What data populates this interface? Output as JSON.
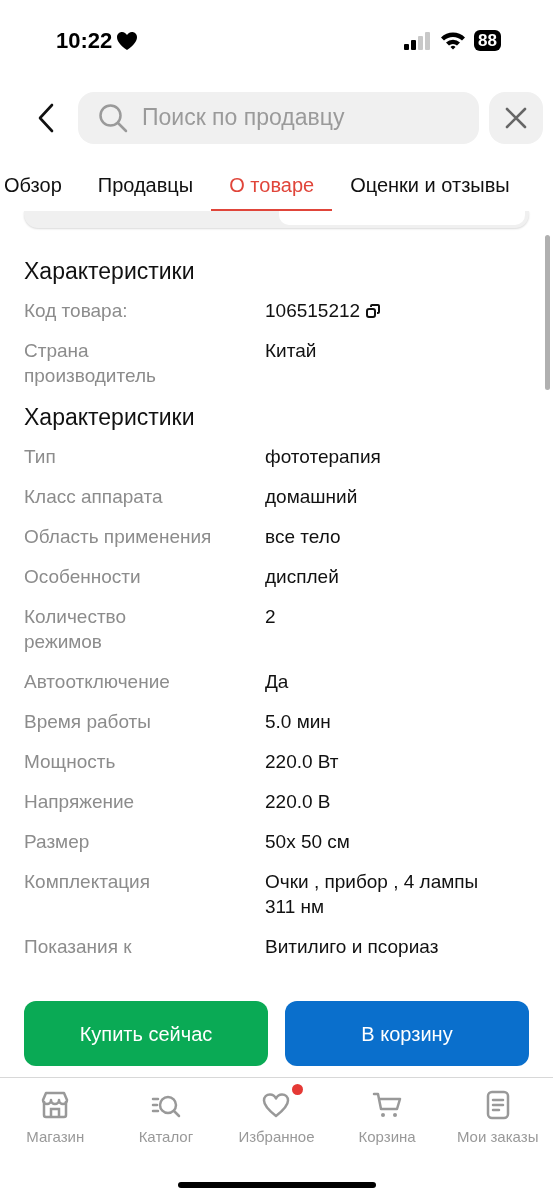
{
  "status_bar": {
    "time": "10:22",
    "battery": "88"
  },
  "search": {
    "placeholder": "Поиск по продавцу"
  },
  "tabs": [
    {
      "label": "Обзор",
      "selected": false
    },
    {
      "label": "Продавцы",
      "selected": false
    },
    {
      "label": "О товаре",
      "selected": true
    },
    {
      "label": "Оценки и отзывы",
      "selected": false
    }
  ],
  "sections": [
    {
      "title": "Характеристики",
      "rows": [
        {
          "label": "Код товара:",
          "value": "106515212",
          "copyable": true
        },
        {
          "label": "Страна\nпроизводитель",
          "value": "Китай"
        }
      ]
    },
    {
      "title": "Характеристики",
      "rows": [
        {
          "label": "Тип",
          "value": "фототерапия"
        },
        {
          "label": "Класс аппарата",
          "value": "домашний"
        },
        {
          "label": "Область применения",
          "value": "все тело"
        },
        {
          "label": "Особенности",
          "value": "дисплей"
        },
        {
          "label": "Количество\nрежимов",
          "value": "2"
        },
        {
          "label": "Автоотключение",
          "value": "Да"
        },
        {
          "label": "Время работы",
          "value": "5.0 мин"
        },
        {
          "label": "Мощность",
          "value": "220.0 Вт"
        },
        {
          "label": "Напряжение",
          "value": "220.0 В"
        },
        {
          "label": "Размер",
          "value": "50х 50 см"
        },
        {
          "label": "Комплектация",
          "value": "Очки , прибор , 4 лампы\n311 нм"
        },
        {
          "label": "Показания к",
          "value": "Витилиго и псориаз"
        }
      ]
    }
  ],
  "buttons": [
    {
      "label": "Купить сейчас",
      "kind": "buy"
    },
    {
      "label": "В корзину",
      "kind": "cart"
    }
  ],
  "nav": [
    {
      "label": "Магазин",
      "kind": "store",
      "badge": false
    },
    {
      "label": "Каталог",
      "kind": "catalog",
      "badge": false
    },
    {
      "label": "Избранное",
      "kind": "favorites",
      "badge": true
    },
    {
      "label": "Корзина",
      "kind": "cart",
      "badge": false
    },
    {
      "label": "Мои заказы",
      "kind": "orders",
      "badge": false
    }
  ]
}
